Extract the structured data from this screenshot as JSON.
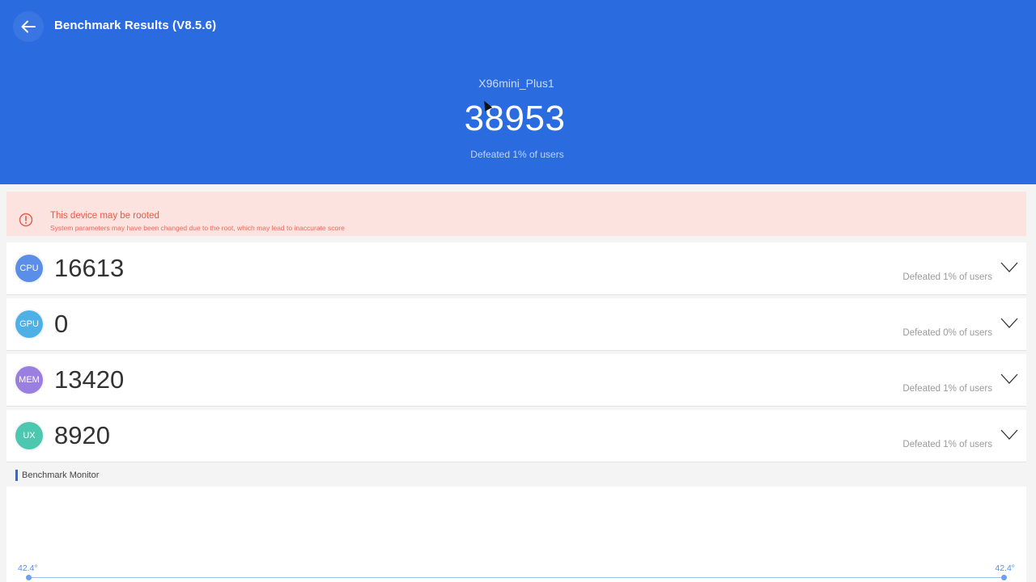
{
  "header": {
    "title": "Benchmark Results (V8.5.6)",
    "device_name": "X96mini_Plus1",
    "total_score": "38953",
    "total_defeated": "Defeated 1% of users",
    "background_color": "#2a6be0"
  },
  "warning": {
    "title": "This device may be rooted",
    "description": "System parameters may have been changed due to the root, which may lead to inaccurate score",
    "icon": "alert-circle-icon"
  },
  "scores": [
    {
      "badge": "CPU",
      "score": "16613",
      "defeated": "Defeated 1% of users",
      "color": "#5b8ee8"
    },
    {
      "badge": "GPU",
      "score": "0",
      "defeated": "Defeated 0% of users",
      "color": "#4db1e8"
    },
    {
      "badge": "MEM",
      "score": "13420",
      "defeated": "Defeated 1% of users",
      "color": "#9a7ee0"
    },
    {
      "badge": "UX",
      "score": "8920",
      "defeated": "Defeated 1% of users",
      "color": "#4dc7b0"
    }
  ],
  "monitor": {
    "title": "Benchmark Monitor",
    "temp_start": "42.4°",
    "temp_end": "42.4°"
  }
}
